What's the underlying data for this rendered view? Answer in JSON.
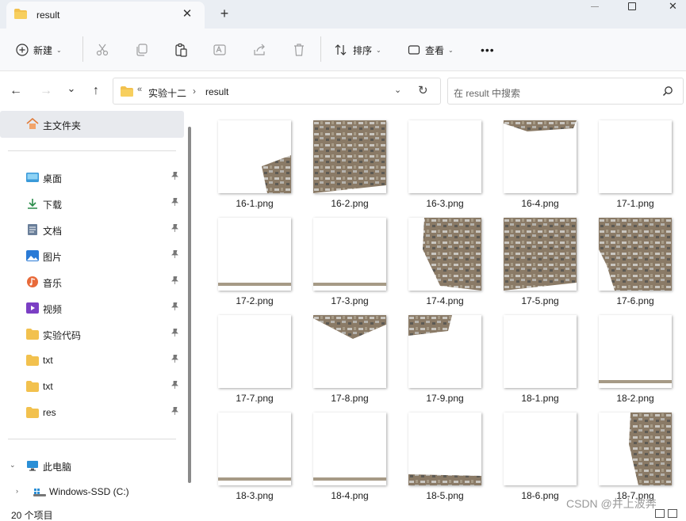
{
  "tab": {
    "title": "result",
    "close": "✕",
    "new_tab": "+"
  },
  "window": {
    "close": "✕"
  },
  "toolbar": {
    "new_label": "新建",
    "sort_label": "排序",
    "view_label": "查看",
    "more_label": "•••"
  },
  "nav": {
    "back": "←",
    "forward": "→",
    "recent": "⌄",
    "up": "↑"
  },
  "address": {
    "overflow": "«",
    "crumbs": [
      "实验十二",
      "result"
    ],
    "separator": "›",
    "refresh": "↻"
  },
  "search": {
    "placeholder": "在 result 中搜索"
  },
  "sidebar": {
    "home": "主文件夹",
    "items": [
      {
        "label": "桌面",
        "icon": "desktop-icon",
        "color": "#3a9ad9"
      },
      {
        "label": "下载",
        "icon": "download-icon",
        "color": "#2a8c4a"
      },
      {
        "label": "文档",
        "icon": "document-icon",
        "color": "#6a7f9a"
      },
      {
        "label": "图片",
        "icon": "pictures-icon",
        "color": "#2b7bd6"
      },
      {
        "label": "音乐",
        "icon": "music-icon",
        "color": "#e86a3a"
      },
      {
        "label": "视频",
        "icon": "video-icon",
        "color": "#7b3fc4"
      },
      {
        "label": "实验代码",
        "icon": "folder-icon",
        "color": "#f2c14e"
      },
      {
        "label": "txt",
        "icon": "folder-icon",
        "color": "#f2c14e"
      },
      {
        "label": "txt",
        "icon": "folder-icon",
        "color": "#f2c14e"
      },
      {
        "label": "res",
        "icon": "folder-icon",
        "color": "#f2c14e"
      }
    ],
    "pin": "📌",
    "this_pc": "此电脑",
    "drive": "Windows-SSD (C:)"
  },
  "files": [
    {
      "name": "16-1.png",
      "content": "corner-br"
    },
    {
      "name": "16-2.png",
      "content": "full"
    },
    {
      "name": "16-3.png",
      "content": "blank"
    },
    {
      "name": "16-4.png",
      "content": "top-strip"
    },
    {
      "name": "17-1.png",
      "content": "blank"
    },
    {
      "name": "17-2.png",
      "content": "bottom-line"
    },
    {
      "name": "17-3.png",
      "content": "bottom-line"
    },
    {
      "name": "17-4.png",
      "content": "diagonal"
    },
    {
      "name": "17-5.png",
      "content": "full"
    },
    {
      "name": "17-6.png",
      "content": "full-right"
    },
    {
      "name": "17-7.png",
      "content": "blank"
    },
    {
      "name": "17-8.png",
      "content": "top-wedge"
    },
    {
      "name": "17-9.png",
      "content": "top-left"
    },
    {
      "name": "18-1.png",
      "content": "blank"
    },
    {
      "name": "18-2.png",
      "content": "bottom-line"
    },
    {
      "name": "18-3.png",
      "content": "bottom-line"
    },
    {
      "name": "18-4.png",
      "content": "bottom-line"
    },
    {
      "name": "18-5.png",
      "content": "bottom-strip"
    },
    {
      "name": "18-6.png",
      "content": "blank"
    },
    {
      "name": "18-7.png",
      "content": "right-half"
    }
  ],
  "status": {
    "count": "20 个项目",
    "watermark": "CSDN @井上波奔"
  }
}
